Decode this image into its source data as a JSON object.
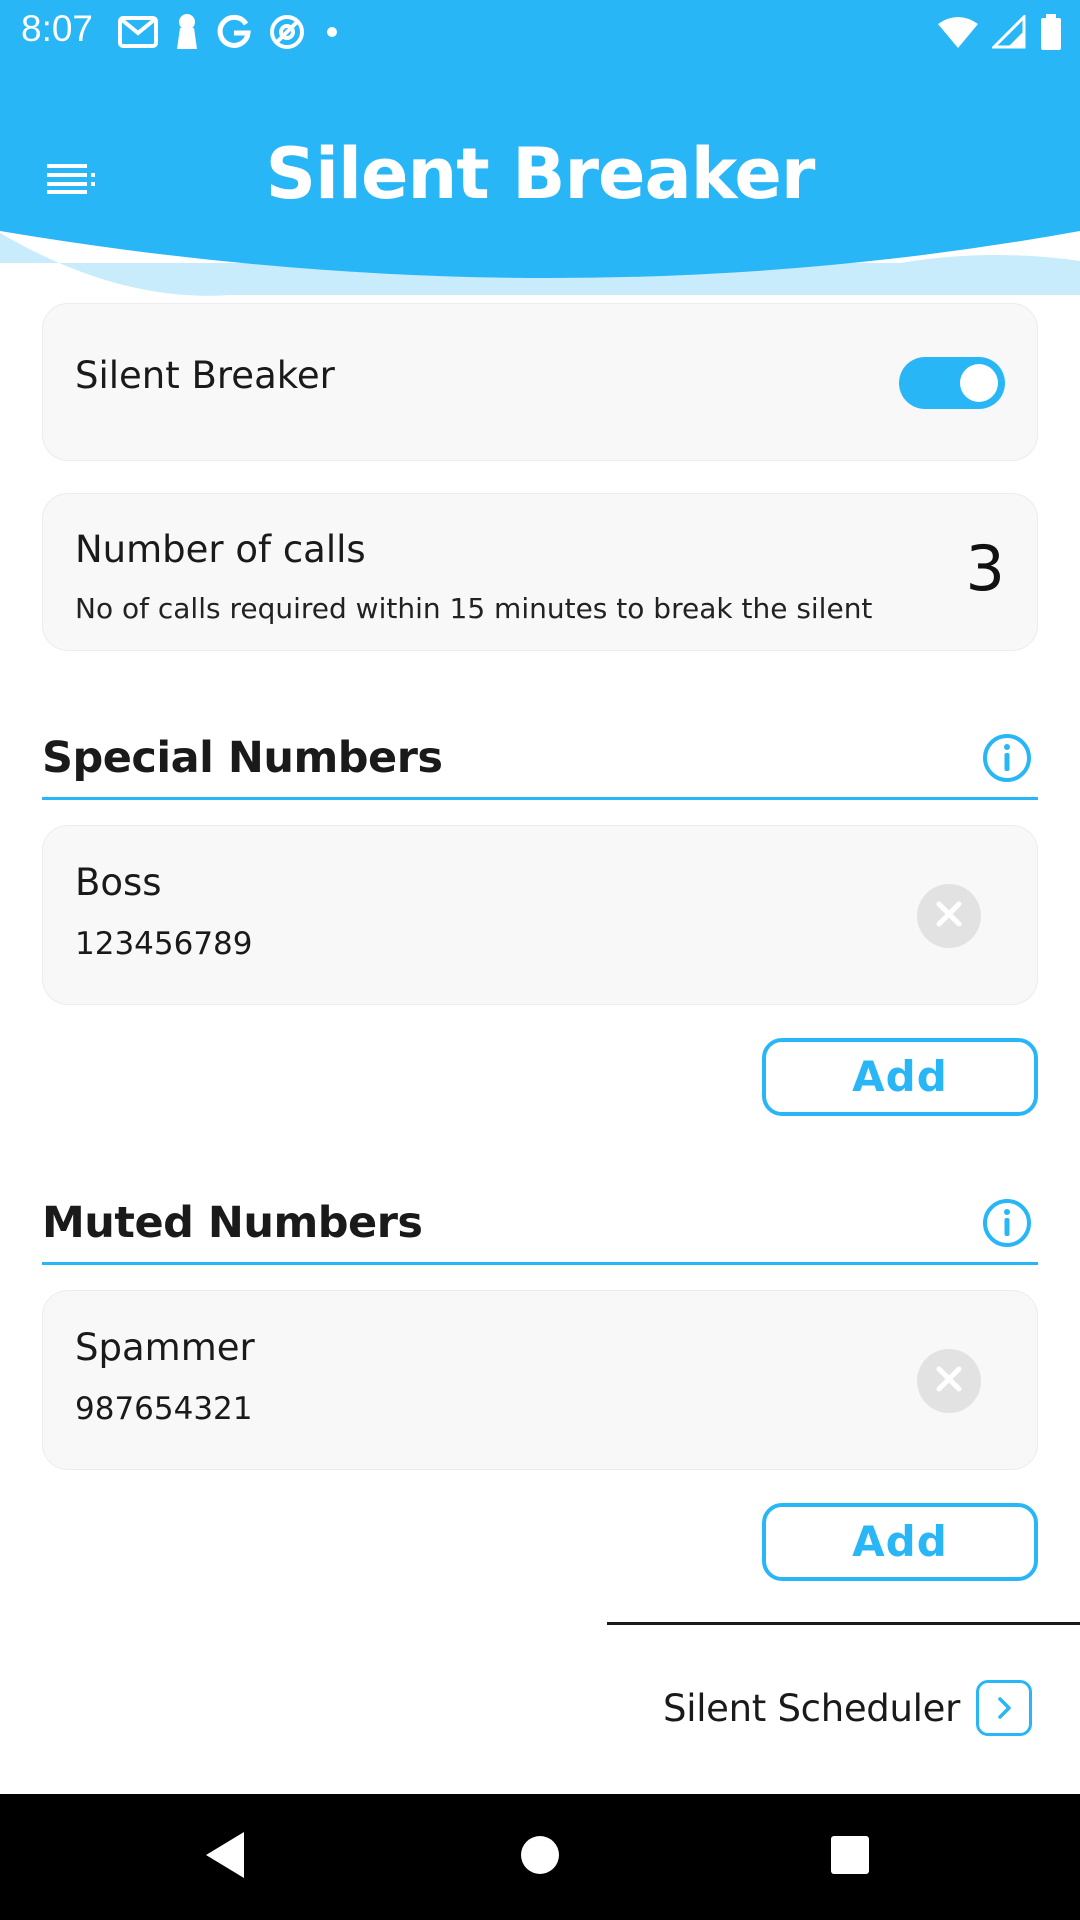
{
  "status_bar": {
    "time": "8:07",
    "left_icons": [
      "gmail-icon",
      "keyhole-icon",
      "google-icon",
      "at-sign-icon",
      "dot-icon"
    ],
    "right_icons": [
      "wifi-icon",
      "cell-signal-icon",
      "battery-icon"
    ]
  },
  "header": {
    "title": "Silent Breaker",
    "menu_icon": "menu-icon",
    "color": "#29b6f6"
  },
  "silent_breaker_card": {
    "label": "Silent Breaker",
    "enabled": true
  },
  "calls_card": {
    "label": "Number of calls",
    "description": "No of calls required within 15 minutes to break the silent",
    "value": "3"
  },
  "special_numbers": {
    "title": "Special Numbers",
    "contacts": [
      {
        "name": "Boss",
        "number": "123456789"
      }
    ],
    "add_label": "Add"
  },
  "muted_numbers": {
    "title": "Muted Numbers",
    "contacts": [
      {
        "name": "Spammer",
        "number": "987654321"
      }
    ],
    "add_label": "Add"
  },
  "footer": {
    "scheduler_label": "Silent Scheduler"
  },
  "colors": {
    "accent": "#29b6f6",
    "card_bg": "#f8f8f8",
    "nav_bar": "#000000"
  }
}
